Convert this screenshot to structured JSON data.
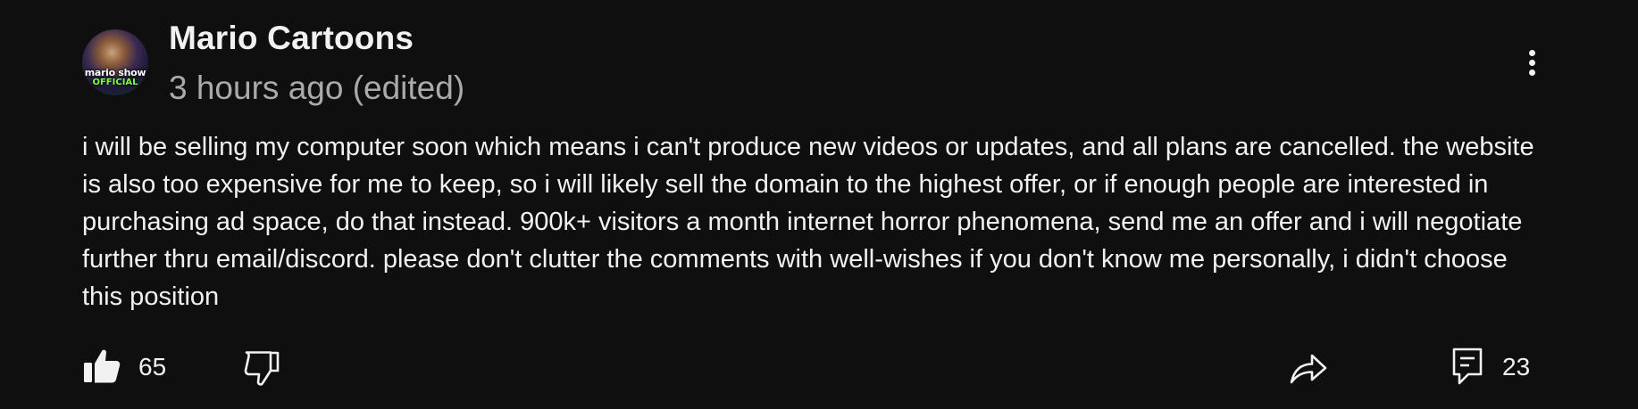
{
  "comment": {
    "author": "Mario Cartoons",
    "timestamp": "3 hours ago (edited)",
    "avatar_text_line1": "mario show",
    "avatar_text_line2": "OFFICIAL",
    "body": "i will be selling my computer soon which means i can't produce new videos or updates, and all plans are cancelled. the website is also too expensive for me to keep, so i will likely sell the domain to the highest offer, or if enough people are interested in purchasing ad space, do that instead. 900k+ visitors a month internet horror phenomena, send me an offer and i will negotiate further thru email/discord. please don't clutter the comments with well-wishes if you don't know me personally, i didn't choose this position"
  },
  "actions": {
    "like_count": "65",
    "reply_count": "23",
    "icons": [
      "thumbs-up-icon",
      "thumbs-down-icon",
      "share-icon",
      "reply-icon",
      "more-vertical-icon"
    ]
  },
  "colors": {
    "background": "#0f0f0f",
    "text": "#f1f1f1",
    "secondary_text": "#aaaaaa"
  }
}
